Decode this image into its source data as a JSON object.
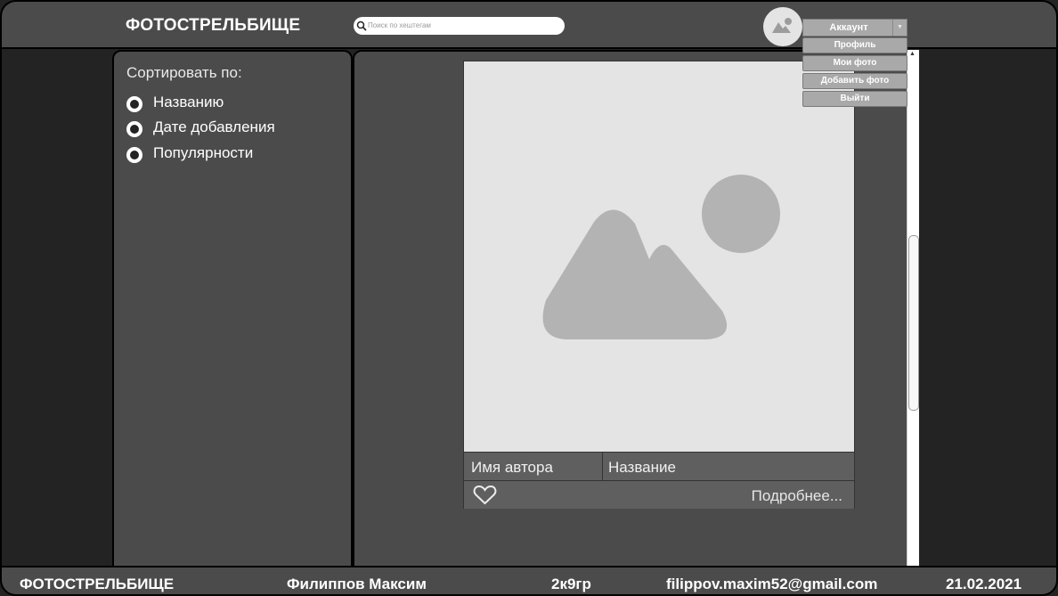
{
  "header": {
    "logo": "ФОТОСТРЕЛЬБИЩЕ",
    "search_placeholder": "Поиск по хештегам",
    "account_label": "Аккаунт"
  },
  "account_menu": {
    "items": [
      {
        "label": "Профиль"
      },
      {
        "label": "Мои фото"
      },
      {
        "label": "Добавить фото"
      },
      {
        "label": "Выйти"
      }
    ]
  },
  "sidebar": {
    "sort_title": "Сортировать по:",
    "options": [
      {
        "label": "Названию"
      },
      {
        "label": "Дате добавления"
      },
      {
        "label": "Популярности"
      }
    ]
  },
  "card": {
    "author": "Имя автора",
    "title": "Название",
    "details_link": "Подробнее..."
  },
  "footer": {
    "logo": "ФОТОСТРЕЛЬБИЩЕ",
    "author_name": "Филиппов Максим",
    "group": "2к9гр",
    "email": "filippov.maxim52@gmail.com",
    "date": "21.02.2021"
  },
  "colors": {
    "background": "#232323",
    "panel": "#4b4b4b",
    "button": "#a9a9a9",
    "placeholder_image": "#e4e4e4",
    "placeholder_shape": "#b3b3b3"
  },
  "icons": [
    "search-icon",
    "avatar-image-icon",
    "chevron-down-icon",
    "image-placeholder-icon",
    "heart-icon",
    "scroll-up-icon"
  ]
}
